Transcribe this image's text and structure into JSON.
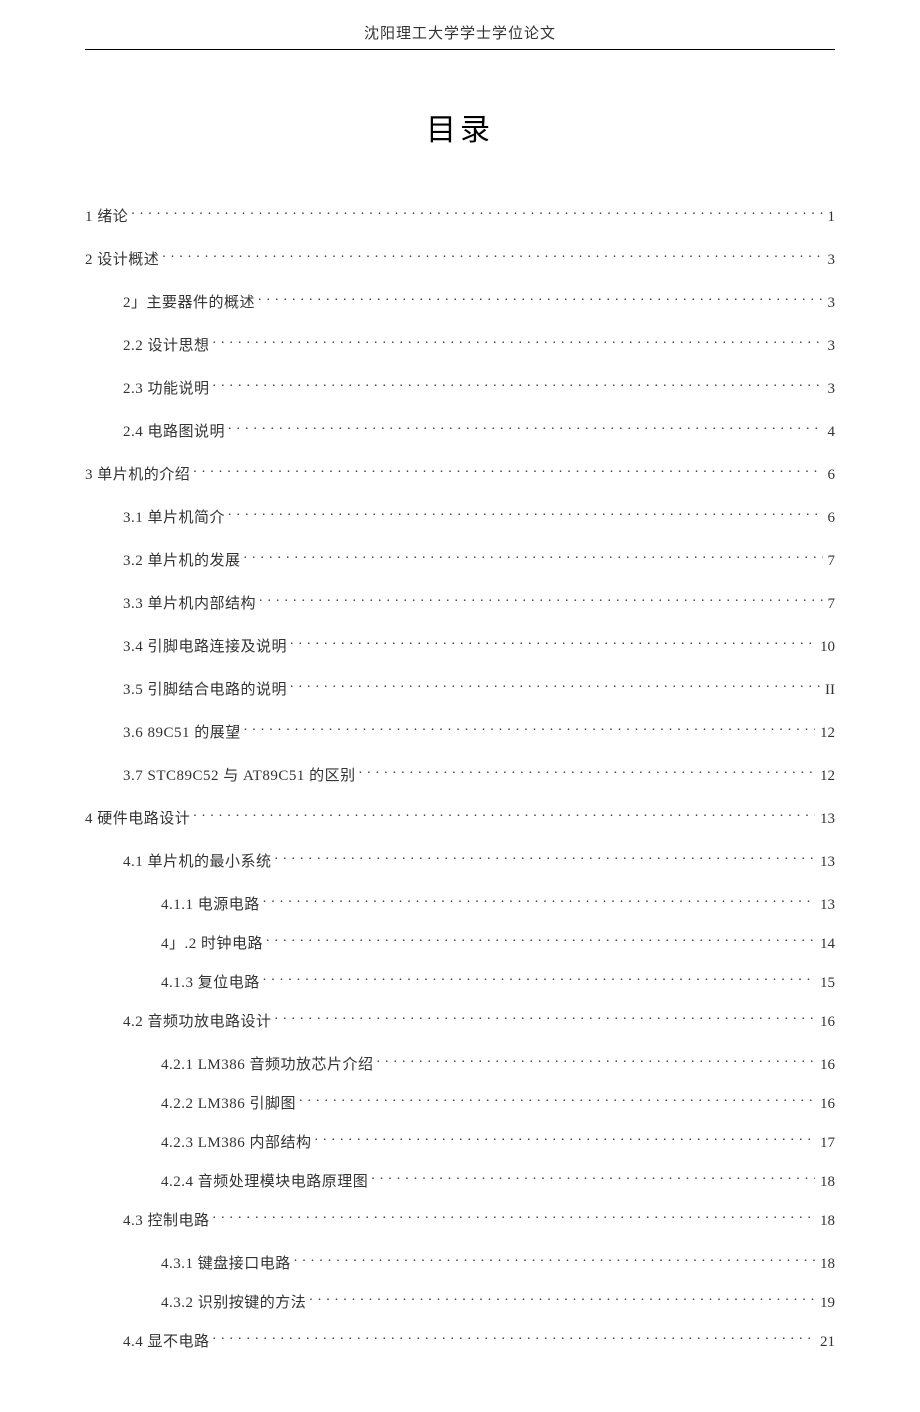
{
  "header": {
    "running_title": "沈阳理工大学学士学位论文"
  },
  "title": "目录",
  "toc": [
    {
      "level": 1,
      "label": "1  绪论",
      "page": "1"
    },
    {
      "level": 1,
      "label": "2 设计概述",
      "page": "3"
    },
    {
      "level": 2,
      "label": "2」主要器件的概述",
      "page": "3"
    },
    {
      "level": 2,
      "label": "2.2 设计思想",
      "page": "3"
    },
    {
      "level": 2,
      "label": "2.3 功能说明",
      "page": "3"
    },
    {
      "level": 2,
      "label": "2.4 电路图说明",
      "page": "4"
    },
    {
      "level": 1,
      "label": "3 单片机的介绍",
      "page": "6"
    },
    {
      "level": 2,
      "label": "3.1 单片机简介",
      "page": "6"
    },
    {
      "level": 2,
      "label": "3.2 单片机的发展",
      "page": "7"
    },
    {
      "level": 2,
      "label": "3.3 单片机内部结构",
      "page": "7"
    },
    {
      "level": 2,
      "label": "3.4 引脚电路连接及说明",
      "page": "10"
    },
    {
      "level": 2,
      "label": "3.5 引脚结合电路的说明",
      "page": "II"
    },
    {
      "level": 2,
      "label": "3.6 89C51 的展望",
      "page": "12"
    },
    {
      "level": 2,
      "label": "3.7 STC89C52 与 AT89C51 的区别",
      "page": "12"
    },
    {
      "level": 1,
      "label": "4 硬件电路设计",
      "page": "13"
    },
    {
      "level": 2,
      "label": "4.1 单片机的最小系统",
      "page": "13"
    },
    {
      "level": 3,
      "label": "4.1.1 电源电路",
      "page": "13"
    },
    {
      "level": 3,
      "label": "4」.2 时钟电路",
      "page": "14"
    },
    {
      "level": 3,
      "label": "4.1.3 复位电路",
      "page": "15"
    },
    {
      "level": 2,
      "label": "4.2 音频功放电路设计",
      "page": "16"
    },
    {
      "level": 3,
      "label": "4.2.1 LM386 音频功放芯片介绍",
      "page": "16"
    },
    {
      "level": 3,
      "label": "4.2.2 LM386 引脚图",
      "page": "16"
    },
    {
      "level": 3,
      "label": "4.2.3 LM386 内部结构",
      "page": "17"
    },
    {
      "level": 3,
      "label": "4.2.4 音频处理模块电路原理图",
      "page": "18"
    },
    {
      "level": 2,
      "label": "4.3 控制电路",
      "page": "18"
    },
    {
      "level": 3,
      "label": "4.3.1 键盘接口电路",
      "page": "18"
    },
    {
      "level": 3,
      "label": "4.3.2 识别按键的方法",
      "page": "19"
    },
    {
      "level": 2,
      "label": "4.4 显不电路",
      "page": "21"
    }
  ]
}
